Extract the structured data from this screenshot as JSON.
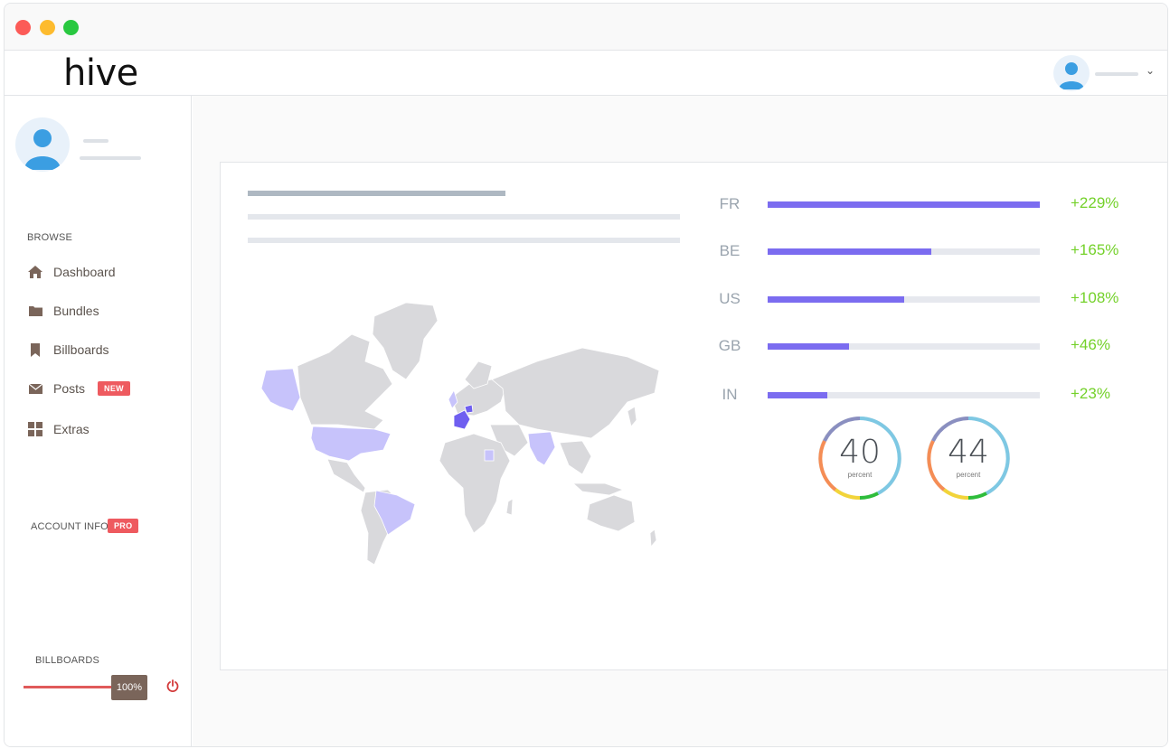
{
  "app": {
    "logo": "hive"
  },
  "sidebar": {
    "browse_label": "BROWSE",
    "items": [
      {
        "label": "Dashboard",
        "icon": "home-icon"
      },
      {
        "label": "Bundles",
        "icon": "folder-icon"
      },
      {
        "label": "Billboards",
        "icon": "bookmark-icon"
      },
      {
        "label": "Posts",
        "icon": "envelope-icon",
        "badge": "NEW"
      },
      {
        "label": "Extras",
        "icon": "grid-icon"
      }
    ],
    "account_label": "ACCOUNT INFO",
    "account_badge": "PRO",
    "billboards_label": "BILLBOARDS",
    "billboards_value": "100%",
    "billboards_level": 1.0
  },
  "stats": [
    {
      "code": "FR",
      "value": "+229%",
      "level": 1.0
    },
    {
      "code": "BE",
      "value": "+165%",
      "level": 0.6
    },
    {
      "code": "US",
      "value": "+108%",
      "level": 0.5
    },
    {
      "code": "GB",
      "value": "+46%",
      "level": 0.3
    },
    {
      "code": "IN",
      "value": "+23%",
      "level": 0.22
    }
  ],
  "gauges": [
    {
      "value": "40",
      "unit": "percent"
    },
    {
      "value": "44",
      "unit": "percent"
    }
  ],
  "colors": {
    "accent": "#7b6cf0",
    "positive": "#74d12a",
    "badge": "#ee5a5f",
    "map_land": "#d9d9dc",
    "map_highlight": "#c7c3fb",
    "map_strong": "#6f5ff0"
  }
}
